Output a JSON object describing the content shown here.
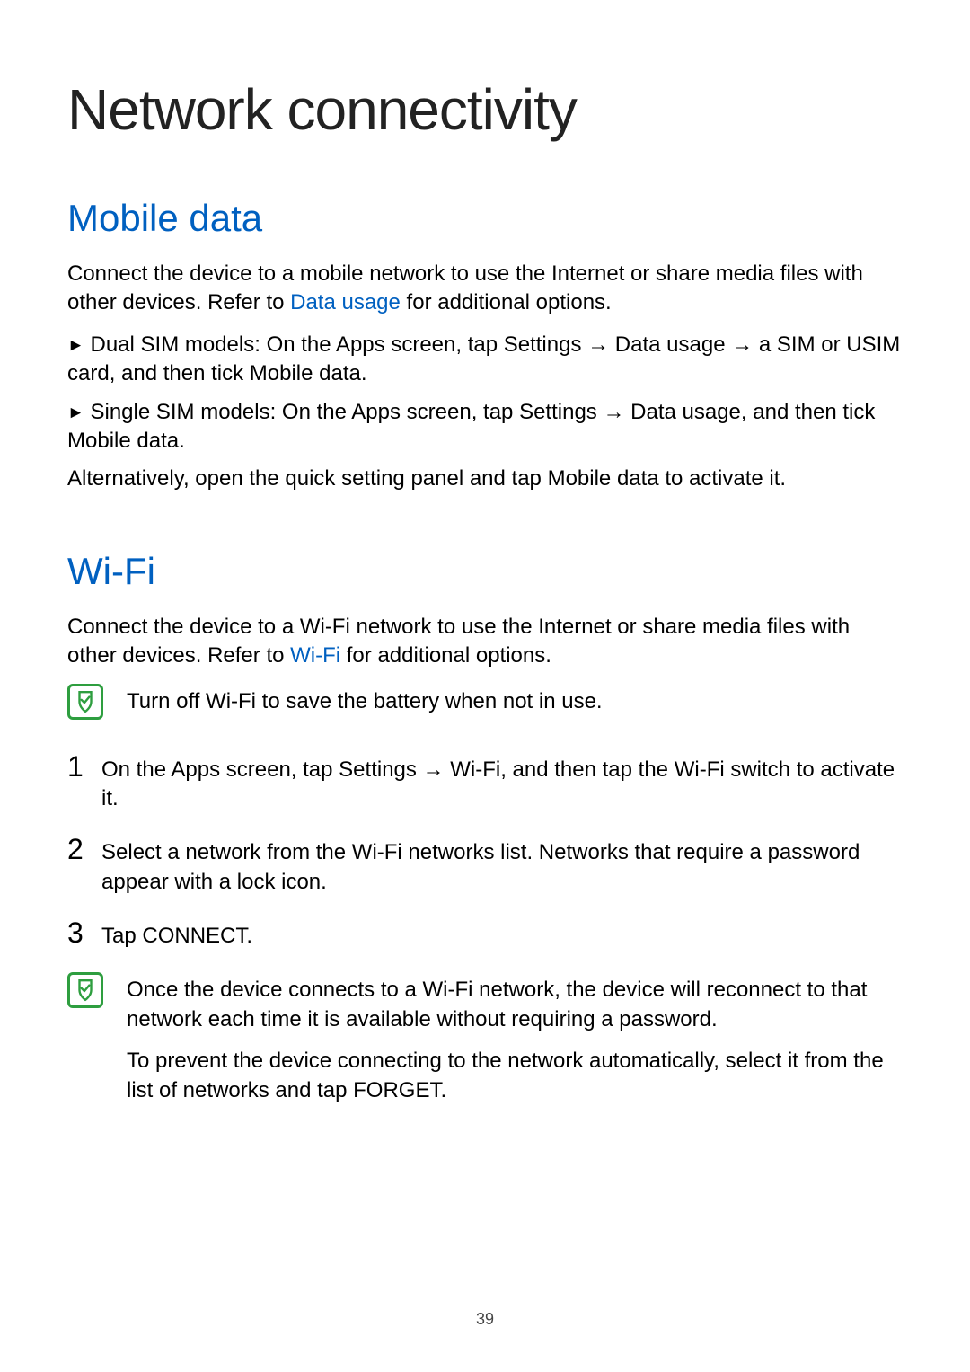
{
  "page_number": "39",
  "h1": "Network connectivity",
  "mobile": {
    "heading": "Mobile data",
    "intro_a": "Connect the device to a mobile network to use the Internet or share media files with other devices. Refer to ",
    "intro_link": "Data usage",
    "intro_b": " for additional options.",
    "dual_bullet": "►",
    "dual_label": "Dual SIM models: ",
    "dual_a": "On the Apps screen, tap ",
    "dual_settings": "Settings",
    "dual_arrow1": " → ",
    "dual_datausage": "Data usage",
    "dual_arrow2": " → ",
    "dual_b": "a SIM or USIM card, and then tick ",
    "dual_mobiledata": "Mobile data",
    "dual_period": ".",
    "single_bullet": "►",
    "single_label": "Single SIM models: ",
    "single_a": "On the Apps screen, tap ",
    "single_settings": "Settings",
    "single_arrow1": " → ",
    "single_datausage": "Data usage",
    "single_b": ", and then tick ",
    "single_mobiledata": "Mobile data",
    "single_period": ".",
    "alt_a": "Alternatively, open the quick setting panel and tap ",
    "alt_mobiledata": "Mobile data",
    "alt_b": " to activate it."
  },
  "wifi": {
    "heading": "Wi-Fi",
    "intro_a": "Connect the device to a Wi-Fi network to use the Internet or share media files with other devices. Refer to ",
    "intro_link": "Wi-Fi",
    "intro_b": " for additional options.",
    "tip": "Turn off Wi-Fi to save the battery when not in use.",
    "step1_num": "1",
    "step1_a": "On the Apps screen, tap ",
    "step1_settings": "Settings",
    "step1_arrow": " → ",
    "step1_wifi": "Wi-Fi",
    "step1_b": ", and then tap the ",
    "step1_switch": "Wi-Fi",
    "step1_c": " switch to activate it.",
    "step2_num": "2",
    "step2": "Select a network from the Wi-Fi networks list. Networks that require a password appear with a lock icon.",
    "step3_num": "3",
    "step3_a": "Tap ",
    "step3_connect": "CONNECT",
    "step3_period": ".",
    "note1": "Once the device connects to a Wi-Fi network, the device will reconnect to that network each time it is available without requiring a password.",
    "note2_a": "To prevent the device connecting to the network automatically, select it from the list of networks and tap ",
    "note2_forget": "FORGET",
    "note2_period": "."
  }
}
